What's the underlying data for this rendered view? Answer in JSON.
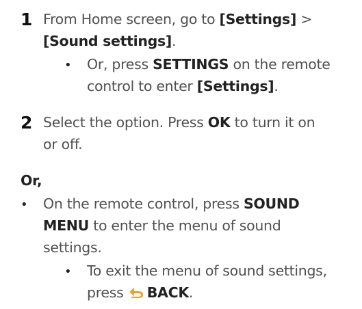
{
  "steps": [
    {
      "number": "1",
      "line1_text": "From Home screen, go to ",
      "line1_bold1": "[Settings]",
      "line1_after": " >",
      "line2_bold": "[Sound settings]",
      "line2_after": ".",
      "sub": {
        "bullet": "•",
        "line1_before": "Or, press ",
        "line1_bold": "SETTINGS",
        "line1_after": " on the remote",
        "line2_text": "control to enter ",
        "line2_bold": "[Settings]",
        "line2_after": "."
      }
    },
    {
      "number": "2",
      "line1_text": "Select the option. Press ",
      "line1_bold": "OK",
      "line1_after": " to turn it on",
      "line2_text": "or off."
    }
  ],
  "or_heading": "Or,",
  "alt": {
    "bullet": "•",
    "line1_before": "On the remote control, press ",
    "line1_bold": "SOUND",
    "line2_bold": "MENU",
    "line2_after": " to enter the menu of sound",
    "line3_text": "settings.",
    "sub": {
      "bullet": "•",
      "line1_text": "To exit the menu of sound settings,",
      "line2_before": "press ",
      "back_icon": "back-arrow-icon",
      "line2_bold": "BACK",
      "line2_after": "."
    }
  },
  "colors": {
    "text": "#505050",
    "bold": "#222222",
    "icon": "#f0a020"
  }
}
